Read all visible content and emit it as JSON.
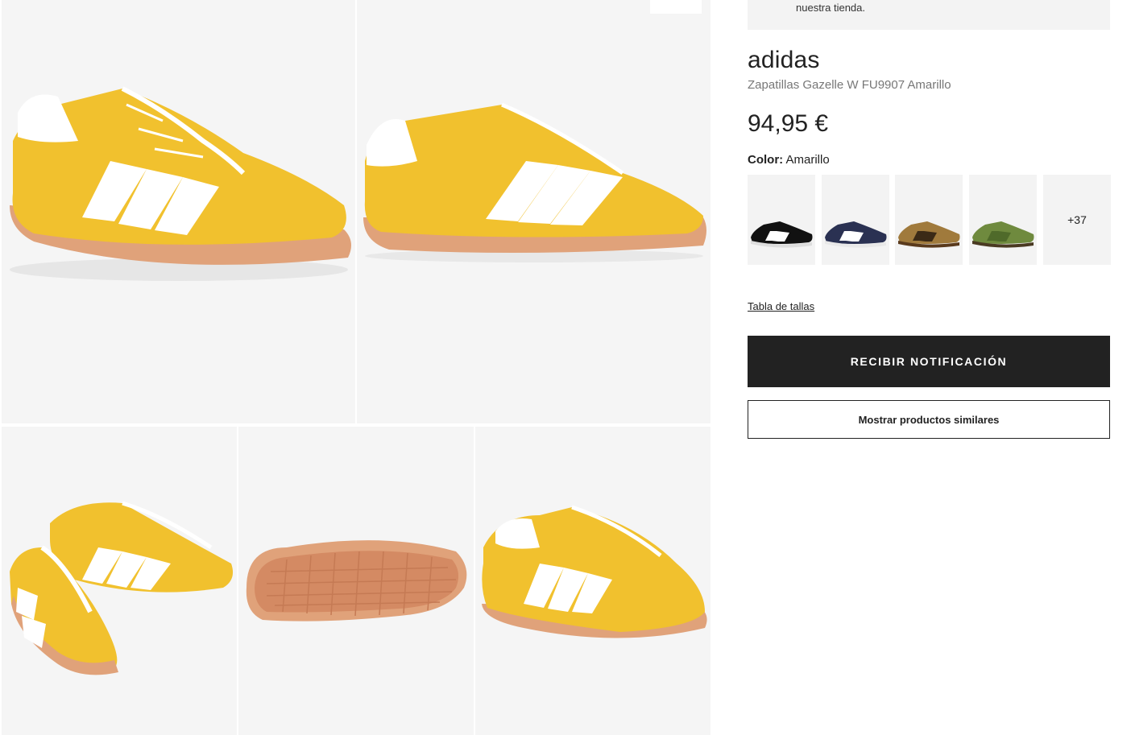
{
  "notice": {
    "text": "nuestra tienda."
  },
  "product": {
    "brand": "adidas",
    "subtitle": "Zapatillas Gazelle W FU9907 Amarillo",
    "price": "94,95 €",
    "color_label": "Color:",
    "color_value": "Amarillo"
  },
  "swatches": {
    "items": [
      {
        "icon": "black-gazelle-swatch",
        "color": "#111111"
      },
      {
        "icon": "navy-gazelle-swatch",
        "color": "#2a3152"
      },
      {
        "icon": "brown-gazelle-swatch",
        "color": "#a07a3c"
      },
      {
        "icon": "green-gazelle-swatch",
        "color": "#6f8a3e"
      }
    ],
    "more_label": "+37"
  },
  "links": {
    "size_chart": "Tabla de tallas"
  },
  "buttons": {
    "notify": "RECIBIR NOTIFICACIÓN",
    "similar": "Mostrar productos similares"
  },
  "gallery": {
    "images": [
      "shoe-side-angle",
      "shoe-profile",
      "shoe-pair",
      "shoe-sole",
      "shoe-front-angle"
    ]
  },
  "colors": {
    "suede_yellow": "#f1c12e",
    "gum_sole": "#e0a27a",
    "stripe_white": "#ffffff",
    "button_dark": "#222222",
    "tile_bg": "#f5f5f5"
  }
}
